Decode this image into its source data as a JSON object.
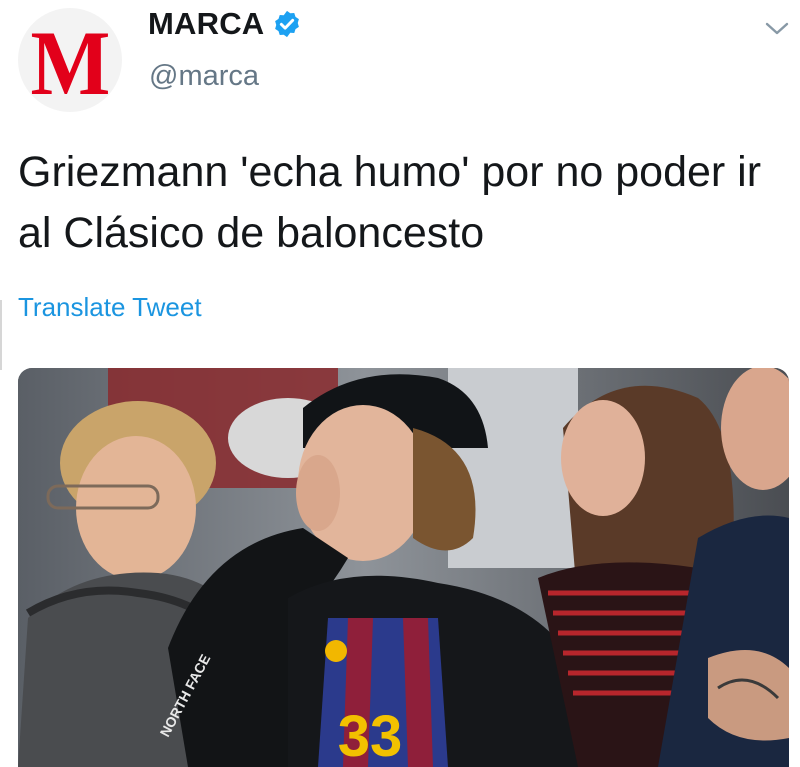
{
  "tweet": {
    "avatar_letter": "M",
    "display_name": "MARCA",
    "handle": "@marca",
    "text": "Griezmann 'echa humo' por no poder ir al Clásico de baloncesto",
    "translate_label": "Translate Tweet"
  },
  "photo": {
    "jersey_number": "33",
    "sleeve_text": "NORTH FACE"
  },
  "icons": {
    "verified": "verified-badge-icon",
    "chevron": "chevron-down-icon"
  },
  "colors": {
    "brand_red": "#e2001a",
    "link_blue": "#1b95e0",
    "verified_blue": "#1da1f2",
    "text_dark": "#14171a",
    "text_gray": "#657786"
  }
}
